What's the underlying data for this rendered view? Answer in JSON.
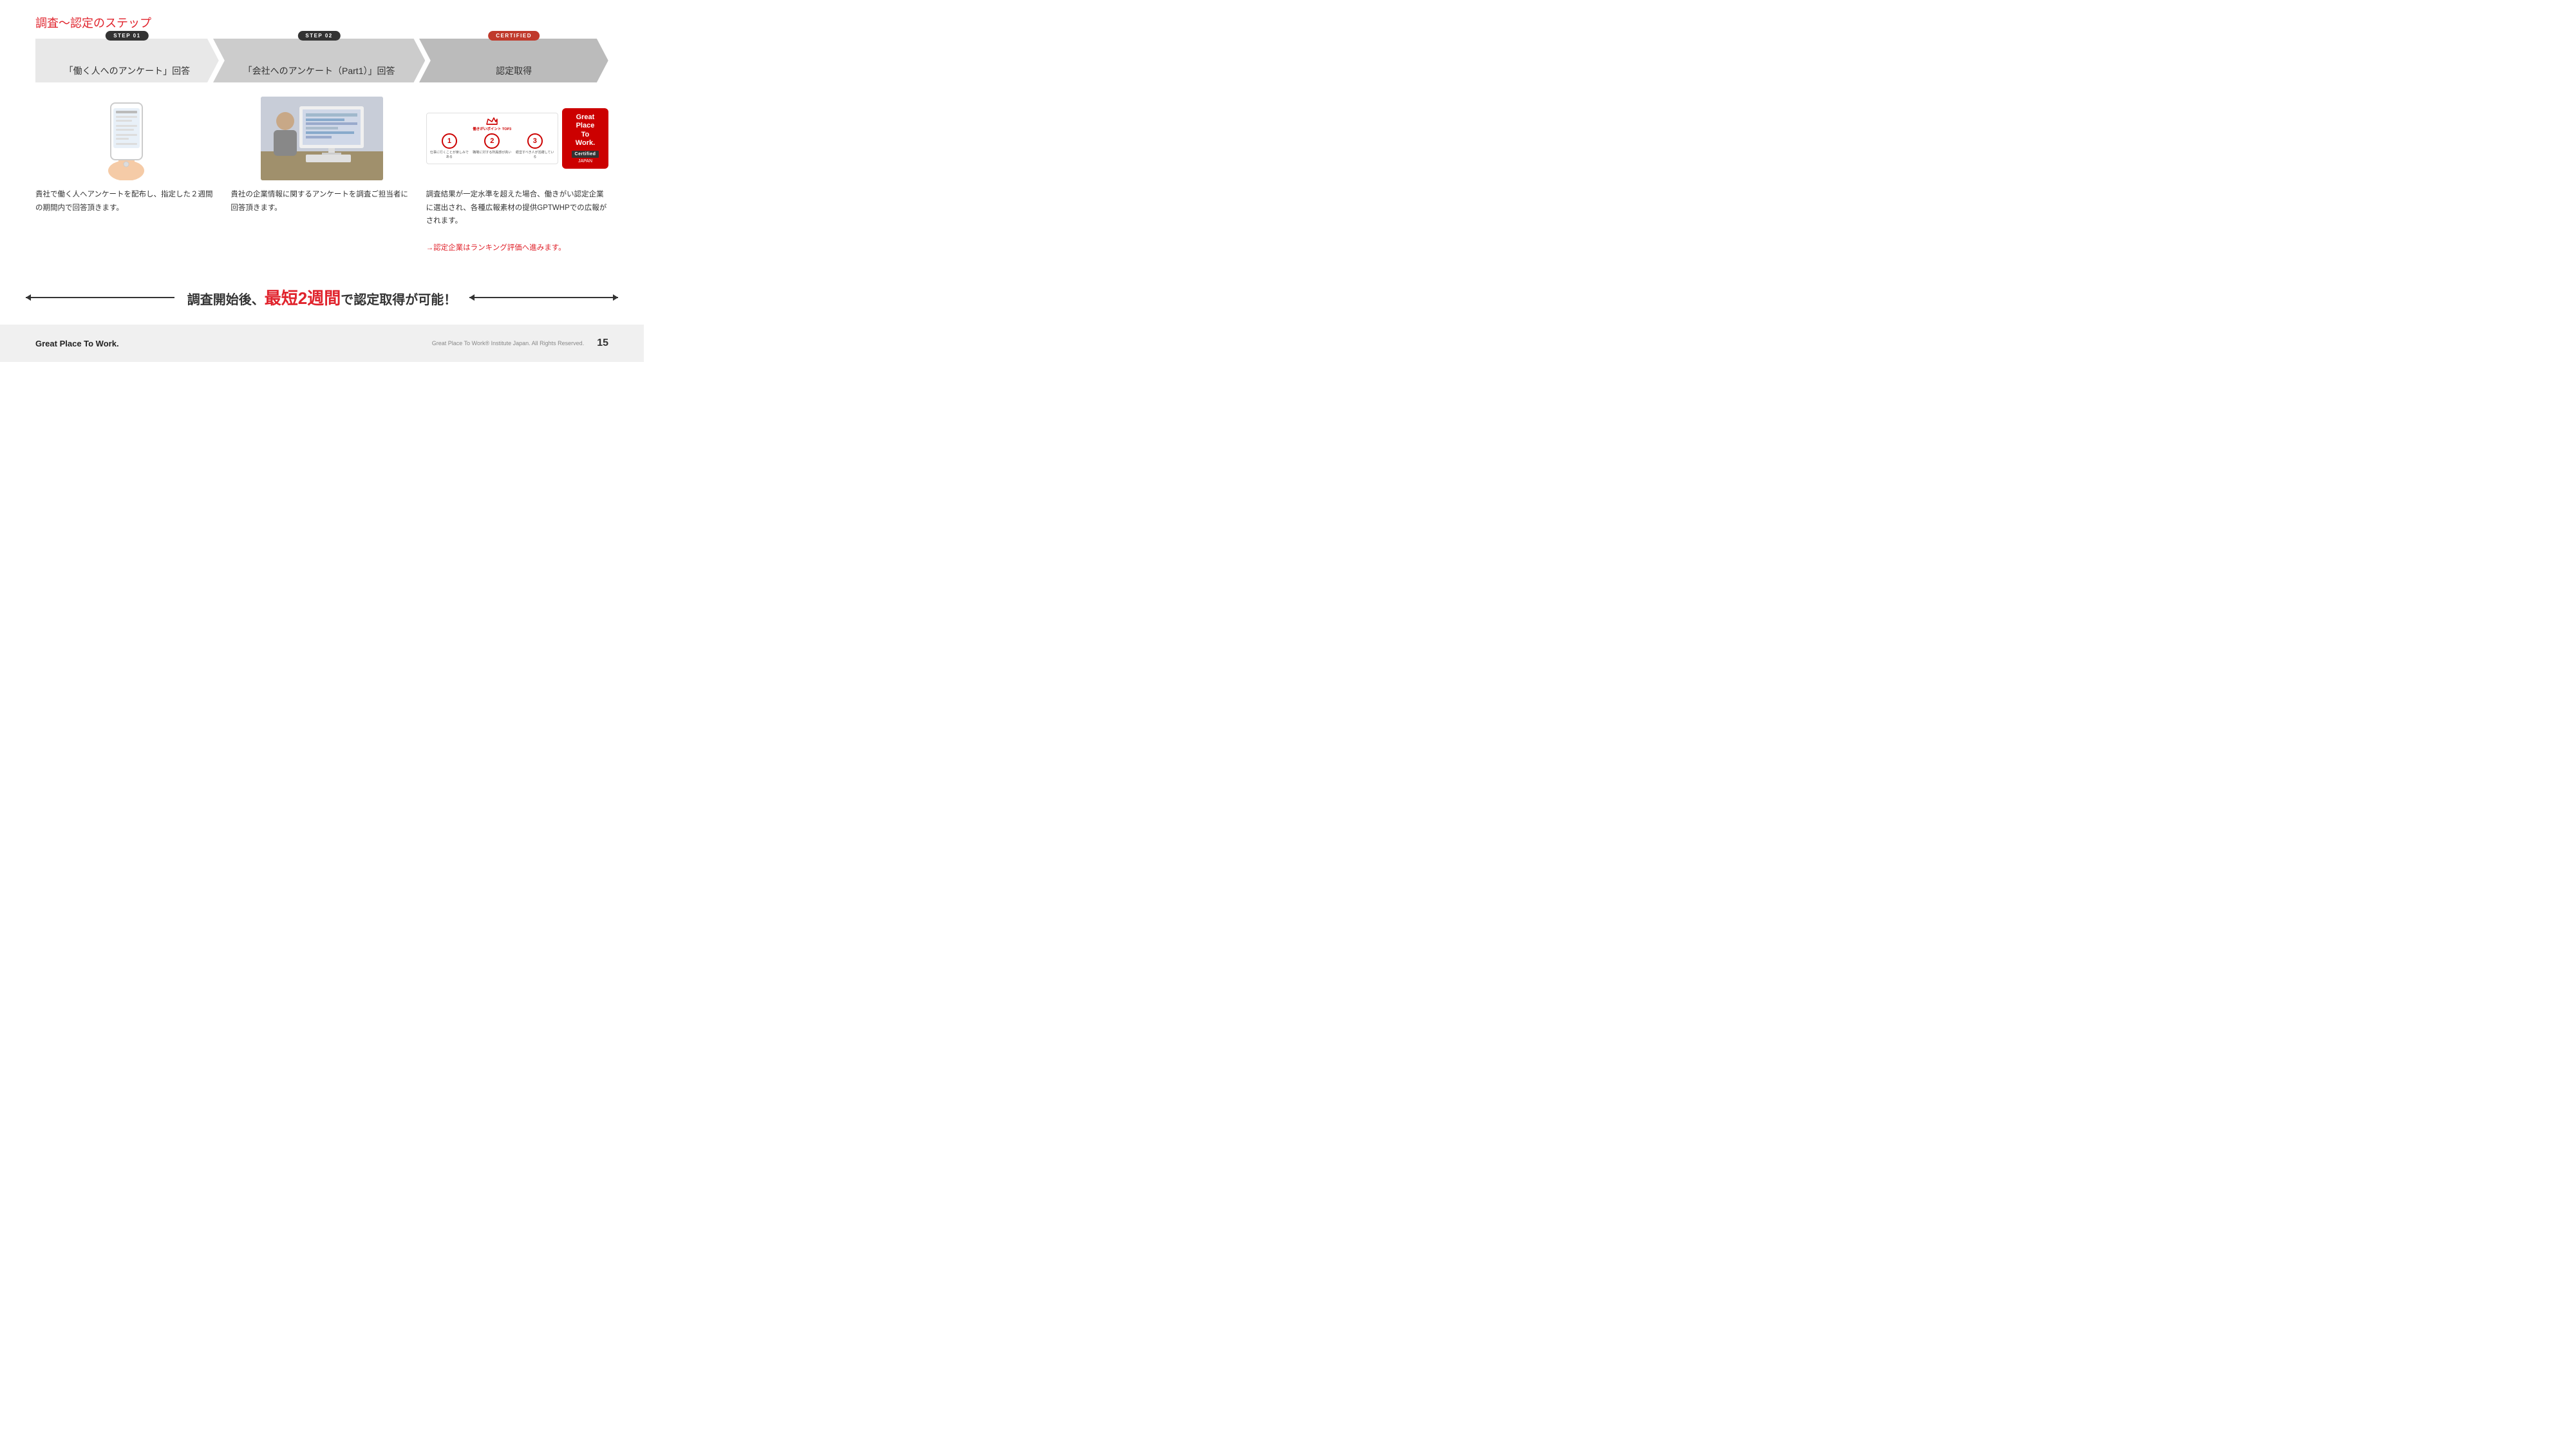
{
  "page": {
    "title": "調査～認定のステップ"
  },
  "steps": [
    {
      "badge": "STEP  01",
      "label": "「働く人へのアンケート」回答",
      "badge_color": "dark"
    },
    {
      "badge": "STEP  02",
      "label": "「会社へのアンケート（Part1）」回答",
      "badge_color": "dark"
    },
    {
      "badge": "CERTIFIED",
      "label": "認定取得",
      "badge_color": "red"
    }
  ],
  "columns": [
    {
      "description": "貴社で働く人へアンケートを配布し、指定した２週間の期間内で回答頂きます。"
    },
    {
      "description": "貴社の企業情報に関するアンケートを調査ご担当者に回答頂きます。"
    },
    {
      "description1": "調査結果が一定水準を超えた場合、働きがい認定企業に選出され、各種広報素材の提供GPTWHPでの広報がされます。",
      "description2": "→認定企業はランキング評価へ進みます。"
    }
  ],
  "cert_card": {
    "title": "働きがいポイント TOP3",
    "items": [
      {
        "num": "1",
        "text": "仕事に行くことが楽しみである"
      },
      {
        "num": "2",
        "text": "職場に対する所属感が高い"
      },
      {
        "num": "3",
        "text": "経営すべき人が活躍している"
      }
    ]
  },
  "gptw_badge": {
    "line1": "Great",
    "line2": "Place",
    "line3": "To",
    "line4": "Work.",
    "certified": "Certified",
    "japan": "JAPAN"
  },
  "banner": {
    "text_before": "調査開始後、",
    "highlight": "最短2週間",
    "text_after": "で認定取得が可能！"
  },
  "footer": {
    "logo": "Great Place To Work.",
    "copyright": "Great Place To Work® Institute Japan. All Rights Reserved.",
    "page_number": "15"
  }
}
